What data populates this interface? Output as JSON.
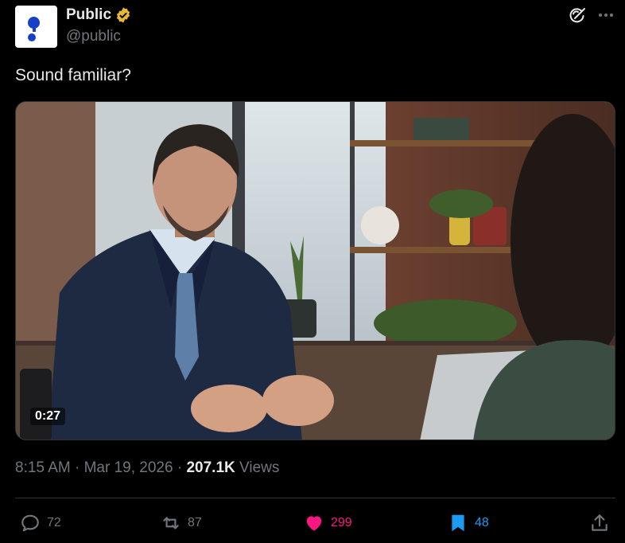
{
  "author": {
    "name": "Public",
    "handle": "@public",
    "verified": true
  },
  "tweet": {
    "text": "Sound familiar?"
  },
  "video": {
    "duration": "0:27"
  },
  "meta": {
    "time": "8:15 AM",
    "date": "Mar 19, 2026",
    "views_count": "207.1K",
    "views_label": "Views",
    "separator": "·"
  },
  "actions": {
    "replies": "72",
    "reposts": "87",
    "likes": "299",
    "bookmarks": "48"
  },
  "icons": [
    "grok-icon",
    "more-icon",
    "verified-icon",
    "reply-icon",
    "repost-icon",
    "like-icon",
    "bookmark-icon",
    "share-icon"
  ],
  "colors": {
    "background": "#000000",
    "text_primary": "#e7e9ea",
    "text_secondary": "#71767b",
    "like_active": "#f91880",
    "bookmark_active": "#1d9bf0",
    "verified_gold": "#e8b92f",
    "brand_blue": "#1640c8"
  }
}
